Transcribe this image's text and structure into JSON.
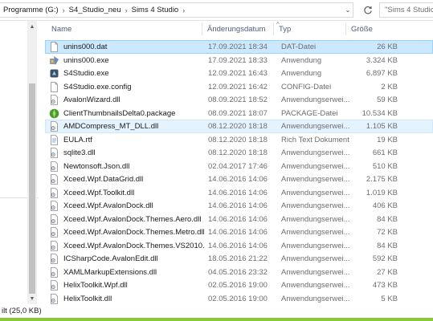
{
  "address_bar": {
    "crumbs": [
      "Programme (G:)",
      "S4_Studio_neu",
      "Sims 4 Studio"
    ],
    "separator": "›",
    "dropdown_glyph": "⌄",
    "refresh_icon": "refresh-icon",
    "search_placeholder": "\"Sims 4 Studio\""
  },
  "columns": {
    "name": "Name",
    "date": "Änderungsdatum",
    "type": "Typ",
    "size": "Größe",
    "sort_glyph": "^"
  },
  "nav_scrollbar": {
    "up": "▲",
    "down": "▼"
  },
  "files": [
    {
      "name": "unins000.dat",
      "date": "17.09.2021 18:34",
      "type": "DAT-Datei",
      "size": "26 KB",
      "icon": "generic-file-icon",
      "state": "selected"
    },
    {
      "name": "unins000.exe",
      "date": "17.09.2021 18:33",
      "type": "Anwendung",
      "size": "3.324 KB",
      "icon": "uninstaller-exe-icon",
      "state": ""
    },
    {
      "name": "S4Studio.exe",
      "date": "12.09.2021 16:43",
      "type": "Anwendung",
      "size": "6.897 KB",
      "icon": "s4studio-app-icon",
      "state": ""
    },
    {
      "name": "S4Studio.exe.config",
      "date": "12.09.2021 16:42",
      "type": "CONFIG-Datei",
      "size": "2 KB",
      "icon": "generic-file-icon",
      "state": ""
    },
    {
      "name": "AvalonWizard.dll",
      "date": "08.09.2021 18:52",
      "type": "Anwendungserwei...",
      "size": "59 KB",
      "icon": "dll-file-icon",
      "state": ""
    },
    {
      "name": "ClientThumbnailsDelta0.package",
      "date": "08.09.2021 18:07",
      "type": "PACKAGE-Datei",
      "size": "10.534 KB",
      "icon": "package-file-icon",
      "state": ""
    },
    {
      "name": "AMDCompress_MT_DLL.dll",
      "date": "08.12.2020 18:18",
      "type": "Anwendungserwei...",
      "size": "1.105 KB",
      "icon": "dll-file-icon",
      "state": "hover"
    },
    {
      "name": "EULA.rtf",
      "date": "08.12.2020 18:18",
      "type": "Rich Text Dokument",
      "size": "19 KB",
      "icon": "rtf-file-icon",
      "state": ""
    },
    {
      "name": "sqlite3.dll",
      "date": "08.12.2020 18:18",
      "type": "Anwendungserwei...",
      "size": "661 KB",
      "icon": "dll-file-icon",
      "state": ""
    },
    {
      "name": "Newtonsoft.Json.dll",
      "date": "02.04.2017 17:46",
      "type": "Anwendungserwei...",
      "size": "510 KB",
      "icon": "dll-file-icon",
      "state": ""
    },
    {
      "name": "Xceed.Wpf.DataGrid.dll",
      "date": "14.06.2016 14:06",
      "type": "Anwendungserwei...",
      "size": "2.175 KB",
      "icon": "dll-file-icon",
      "state": ""
    },
    {
      "name": "Xceed.Wpf.Toolkit.dll",
      "date": "14.06.2016 14:06",
      "type": "Anwendungserwei...",
      "size": "1.019 KB",
      "icon": "dll-file-icon",
      "state": ""
    },
    {
      "name": "Xceed.Wpf.AvalonDock.dll",
      "date": "14.06.2016 14:06",
      "type": "Anwendungserwei...",
      "size": "406 KB",
      "icon": "dll-file-icon",
      "state": ""
    },
    {
      "name": "Xceed.Wpf.AvalonDock.Themes.Aero.dll",
      "date": "14.06.2016 14:06",
      "type": "Anwendungserwei...",
      "size": "84 KB",
      "icon": "dll-file-icon",
      "state": ""
    },
    {
      "name": "Xceed.Wpf.AvalonDock.Themes.Metro.dll",
      "date": "14.06.2016 14:06",
      "type": "Anwendungserwei...",
      "size": "72 KB",
      "icon": "dll-file-icon",
      "state": ""
    },
    {
      "name": "Xceed.Wpf.AvalonDock.Themes.VS2010.dll",
      "date": "14.06.2016 14:06",
      "type": "Anwendungserwei...",
      "size": "84 KB",
      "icon": "dll-file-icon",
      "state": ""
    },
    {
      "name": "ICSharpCode.AvalonEdit.dll",
      "date": "18.05.2016 21:22",
      "type": "Anwendungserwei...",
      "size": "592 KB",
      "icon": "dll-file-icon",
      "state": ""
    },
    {
      "name": "XAMLMarkupExtensions.dll",
      "date": "04.05.2016 23:32",
      "type": "Anwendungserwei...",
      "size": "27 KB",
      "icon": "dll-file-icon",
      "state": ""
    },
    {
      "name": "HelixToolkit.Wpf.dll",
      "date": "02.05.2016 19:00",
      "type": "Anwendungserwei...",
      "size": "473 KB",
      "icon": "dll-file-icon",
      "state": ""
    },
    {
      "name": "HelixToolkit.dll",
      "date": "02.05.2016 19:00",
      "type": "Anwendungserwei...",
      "size": "5 KB",
      "icon": "dll-file-icon",
      "state": ""
    }
  ],
  "status_bar": {
    "text": "ilt (25,0 KB)"
  },
  "colors": {
    "selection_fill": "#cce8ff",
    "selection_border": "#99d1ff",
    "hover_fill": "#e5f3ff",
    "header_text": "#4c607a",
    "bottom_accent": "#8dc63f"
  }
}
